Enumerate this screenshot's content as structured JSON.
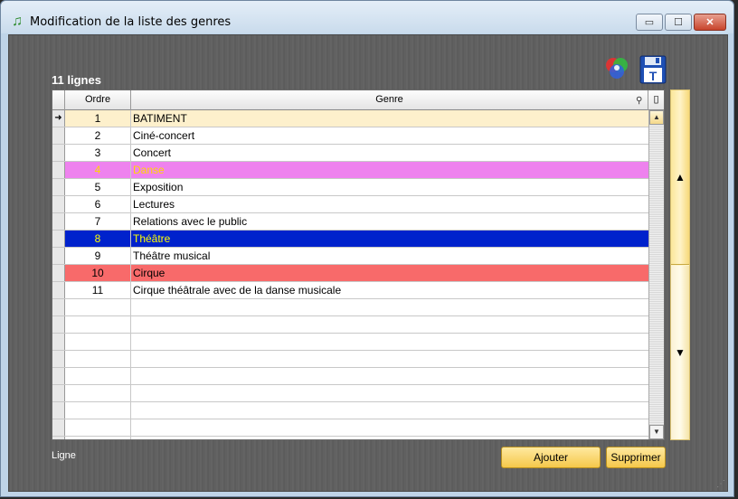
{
  "window": {
    "title": "Modification de la liste des genres",
    "minimize": "▭",
    "maximize": "☐",
    "close": "✕"
  },
  "list": {
    "count_label": "11 lignes",
    "columns": {
      "ordre": "Ordre",
      "genre": "Genre"
    },
    "rows": [
      {
        "ordre": "1",
        "genre": "BATIMENT",
        "current": true,
        "bg": "#fdf0cc",
        "fg": "#000000"
      },
      {
        "ordre": "2",
        "genre": "Ciné-concert",
        "bg": "#ffffff",
        "fg": "#000000"
      },
      {
        "ordre": "3",
        "genre": "Concert",
        "bg": "#ffffff",
        "fg": "#000000"
      },
      {
        "ordre": "4",
        "genre": "Danse",
        "bg": "#ee82ee",
        "fg": "#ffd700"
      },
      {
        "ordre": "5",
        "genre": "Exposition",
        "bg": "#ffffff",
        "fg": "#000000"
      },
      {
        "ordre": "6",
        "genre": "Lectures",
        "bg": "#ffffff",
        "fg": "#000000"
      },
      {
        "ordre": "7",
        "genre": "Relations avec le public",
        "bg": "#ffffff",
        "fg": "#000000"
      },
      {
        "ordre": "8",
        "genre": "Théâtre",
        "bg": "#0022cc",
        "fg": "#ffff00"
      },
      {
        "ordre": "9",
        "genre": "Théâtre musical",
        "bg": "#ffffff",
        "fg": "#000000"
      },
      {
        "ordre": "10",
        "genre": "Cirque",
        "bg": "#f86a6a",
        "fg": "#000000"
      },
      {
        "ordre": "11",
        "genre": "Cirque théâtrale avec de la danse musicale",
        "bg": "#ffffff",
        "fg": "#000000"
      }
    ],
    "empty_rows": 9
  },
  "footer": {
    "ligne_label": "Ligne",
    "add_label": "Ajouter",
    "delete_label": "Supprimer"
  },
  "icons": {
    "app": "music-note-icon",
    "color_picker": "color-wheel-icon",
    "save": "floppy-disk-icon",
    "sort": "search-icon",
    "column_menu": "column-menu-icon",
    "row_pointer": "arrow-right-icon",
    "side_up": "triangle-up-icon",
    "side_down": "triangle-down-icon"
  }
}
